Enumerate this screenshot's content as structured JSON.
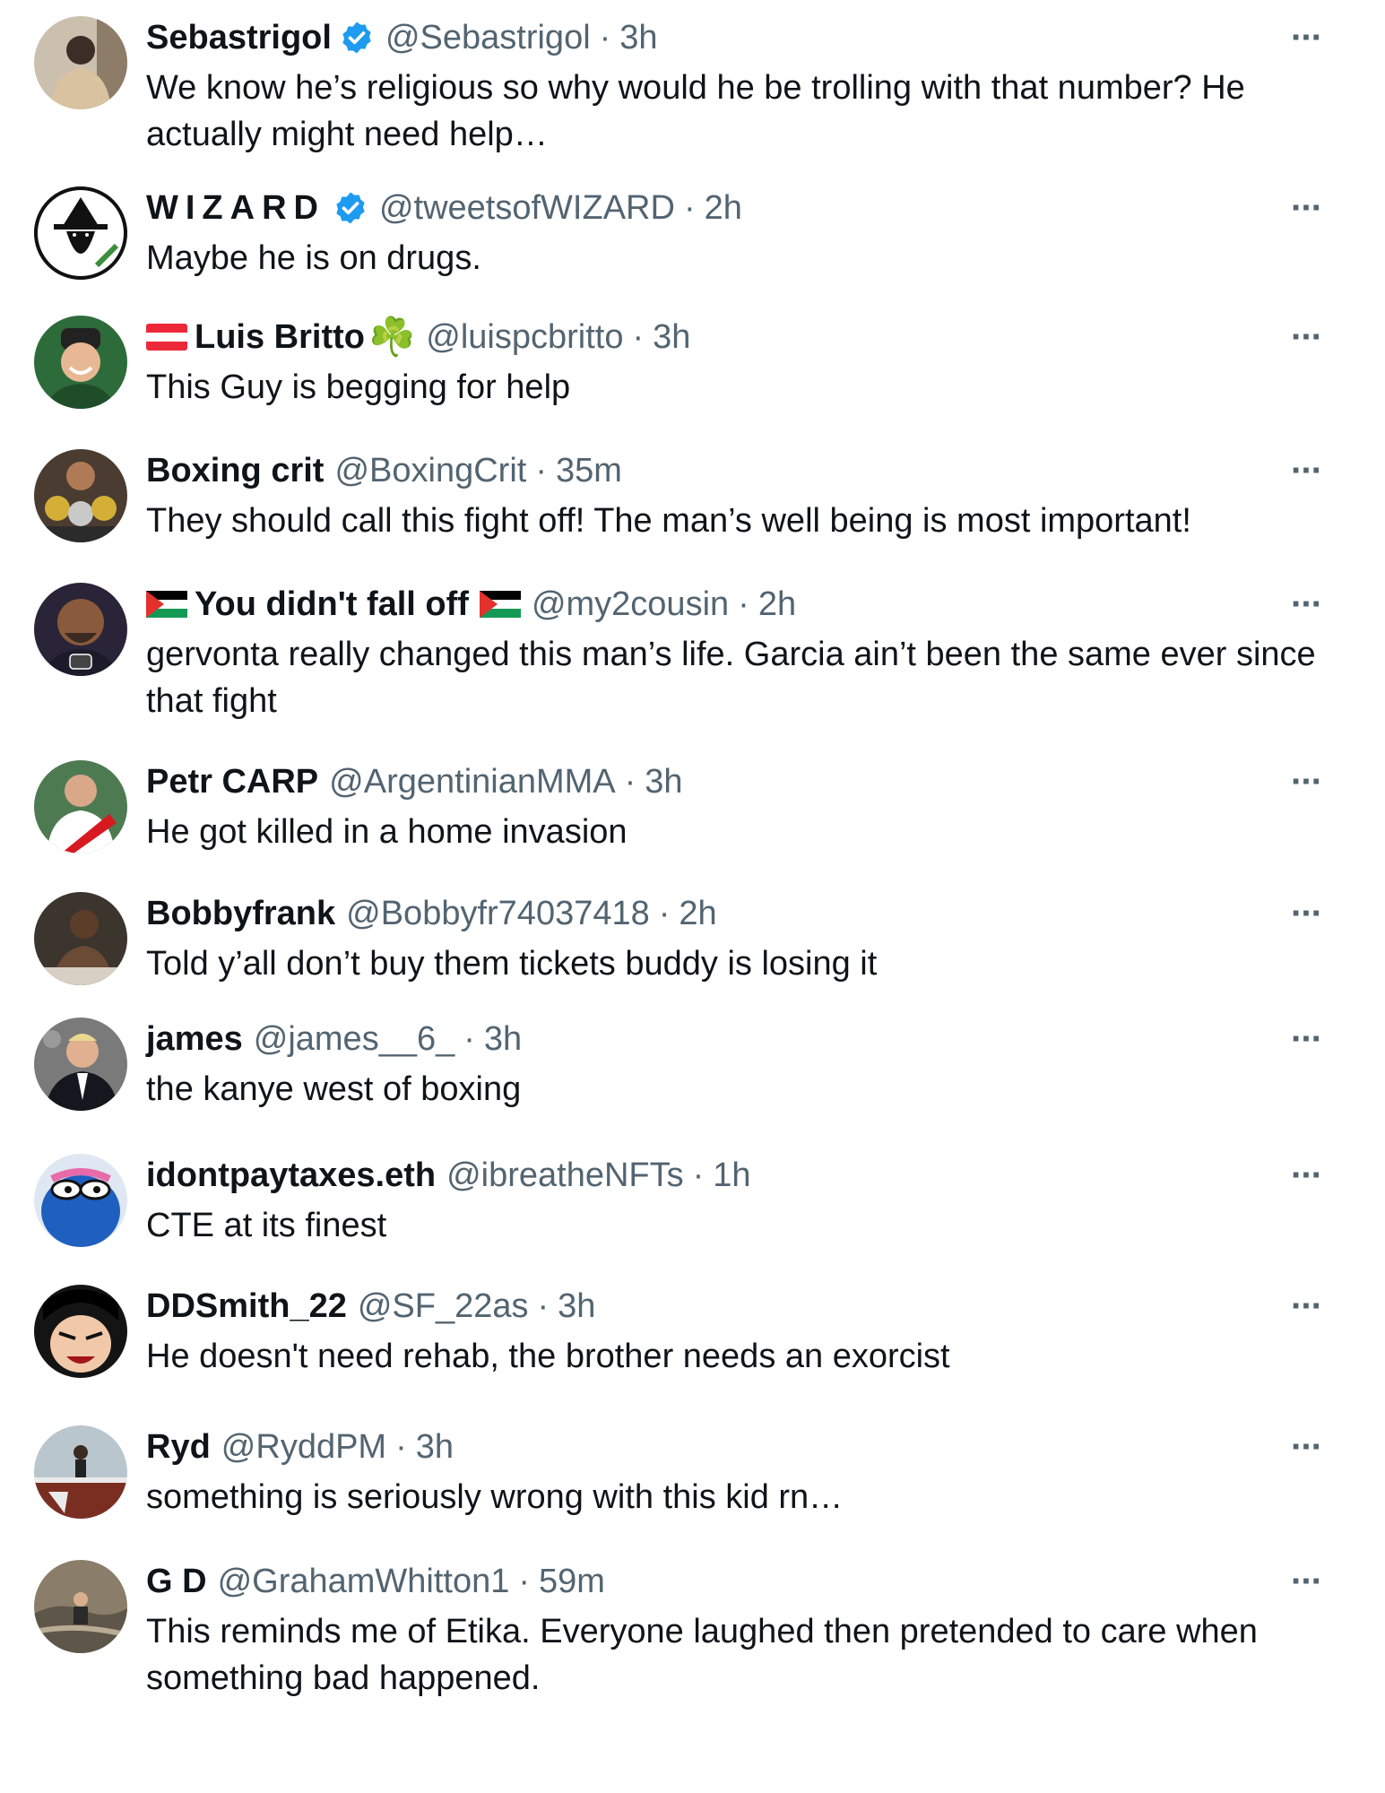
{
  "colors": {
    "text": "#0f1419",
    "muted": "#536471",
    "verified": "#1d9bf0"
  },
  "replies": [
    {
      "name": "Sebastrigol",
      "handle": "@Sebastrigol",
      "time": "3h",
      "verified": true,
      "text": "We know he’s religious so why would he be trolling with that number? He actually might need help…",
      "avatar_icon": "person-jacket-avatar",
      "avatar_bg": "#b8a48a"
    },
    {
      "name": "WIZARD",
      "handle": "@tweetsofWIZARD",
      "time": "2h",
      "verified": true,
      "text": "Maybe he is on drugs.",
      "avatar_icon": "wizard-logo-avatar",
      "avatar_bg": "#ffffff"
    },
    {
      "name": "Luis Britto",
      "handle": "@luispcbritto",
      "time": "3h",
      "verified": false,
      "text": "This Guy is begging for help",
      "avatar_icon": "smiling-man-avatar",
      "avatar_bg": "#2e6b3a",
      "prefix_flag": "austria-flag-icon",
      "suffix_emoji": "☘️"
    },
    {
      "name": "Boxing crit",
      "handle": "@BoxingCrit",
      "time": "35m",
      "verified": false,
      "text": "They should call this fight off! The man’s well being is most important!",
      "avatar_icon": "boxer-belts-avatar",
      "avatar_bg": "#5a4a3a"
    },
    {
      "name": "You didn't fall off",
      "handle": "@my2cousin",
      "time": "2h",
      "verified": false,
      "text": "gervonta really changed this man’s life. Garcia ain’t been the same ever since that fight",
      "avatar_icon": "bald-man-avatar",
      "avatar_bg": "#2a2438",
      "prefix_flag": "palestine-flag-icon",
      "suffix_flag": "palestine-flag-icon"
    },
    {
      "name": "Petr CARP",
      "handle": "@ArgentinianMMA",
      "time": "3h",
      "verified": false,
      "text": "He got killed in a home invasion",
      "avatar_icon": "river-plate-jersey-avatar",
      "avatar_bg": "#3f6b45"
    },
    {
      "name": "Bobbyfrank",
      "handle": "@Bobbyfr74037418",
      "time": "2h",
      "verified": false,
      "text": "Told y’all don’t buy them tickets buddy is losing it",
      "avatar_icon": "man-dark-room-avatar",
      "avatar_bg": "#3b352e"
    },
    {
      "name": "james",
      "handle": "@james__6_",
      "time": "3h",
      "verified": false,
      "text": "the kanye west of boxing",
      "avatar_icon": "man-suit-avatar",
      "avatar_bg": "#6d6d6d"
    },
    {
      "name": "idontpaytaxes.eth",
      "handle": "@ibreatheNFTs",
      "time": "1h",
      "verified": false,
      "text": "CTE at its finest",
      "avatar_icon": "blue-frog-avatar",
      "avatar_bg": "#1f5fbf"
    },
    {
      "name": "DDSmith_22",
      "handle": "@SF_22as",
      "time": "3h",
      "verified": false,
      "text": "He doesn't need rehab, the brother needs an exorcist",
      "avatar_icon": "anime-face-avatar",
      "avatar_bg": "#1a1a1a"
    },
    {
      "name": "Ryd",
      "handle": "@RyddPM",
      "time": "3h",
      "verified": false,
      "text": "something is seriously wrong with this kid rn…",
      "avatar_icon": "person-on-railing-avatar",
      "avatar_bg": "#9aa8b2"
    },
    {
      "name": "G D",
      "handle": "@GrahamWhitton1",
      "time": "59m",
      "verified": false,
      "text": "This reminds me of Etika. Everyone laughed then pretended to care when something bad happened.",
      "avatar_icon": "person-on-rocks-avatar",
      "avatar_bg": "#8a7e6a"
    }
  ],
  "more_label": "···",
  "dot": "·"
}
